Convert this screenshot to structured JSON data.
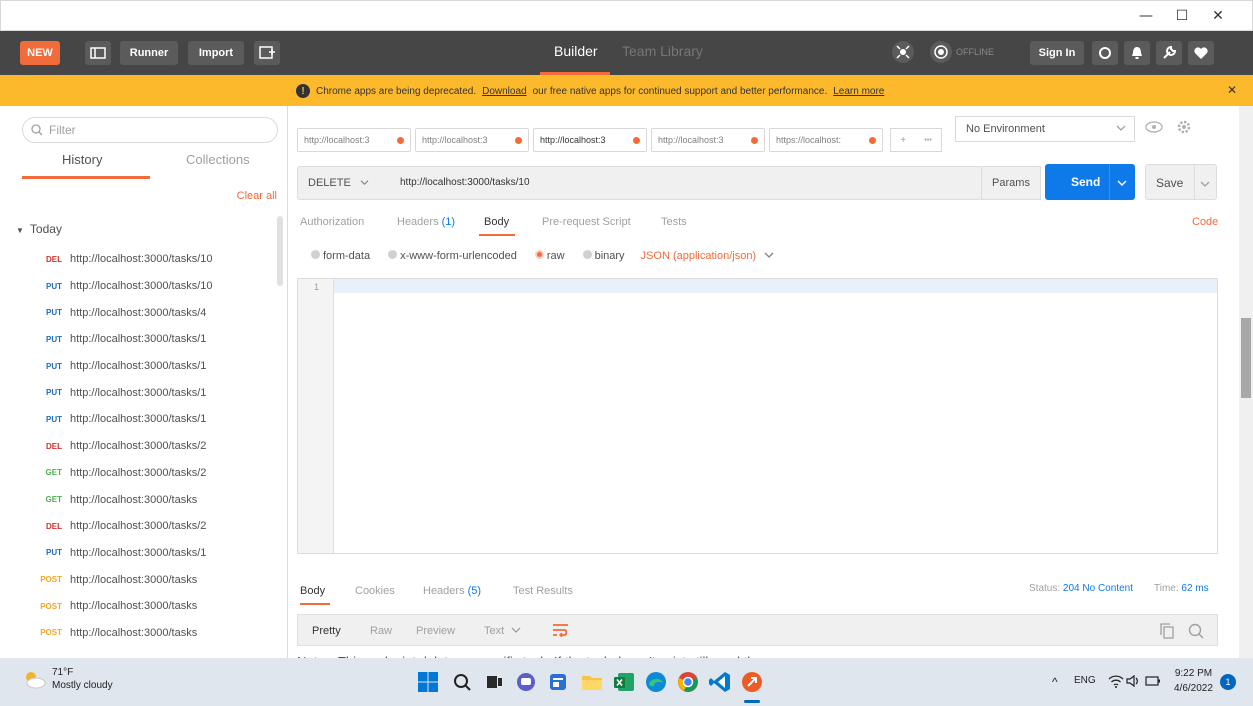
{
  "window": {
    "minimize": "—",
    "maximize": "☐",
    "close": "✕"
  },
  "header": {
    "new_label": "NEW",
    "runner_label": "Runner",
    "import_label": "Import",
    "builder_label": "Builder",
    "team_library_label": "Team Library",
    "offline_label": "OFFLINE",
    "sign_in_label": "Sign In"
  },
  "banner": {
    "text_before": "Chrome apps are being deprecated.",
    "download_link": "Download",
    "text_after": "our free native apps for continued support and better performance.",
    "learn_more": "Learn more",
    "close": "✕"
  },
  "sidebar": {
    "filter_placeholder": "Filter",
    "tabs": [
      "History",
      "Collections"
    ],
    "clear_all": "Clear all",
    "group_label": "Today",
    "items": [
      {
        "method": "DEL",
        "url": "http://localhost:3000/tasks/10",
        "color": "#d0312d"
      },
      {
        "method": "PUT",
        "url": "http://localhost:3000/tasks/10",
        "color": "#1e6bbf"
      },
      {
        "method": "PUT",
        "url": "http://localhost:3000/tasks/4",
        "color": "#1e6bbf"
      },
      {
        "method": "PUT",
        "url": "http://localhost:3000/tasks/1",
        "color": "#1e6bbf"
      },
      {
        "method": "PUT",
        "url": "http://localhost:3000/tasks/1",
        "color": "#1e6bbf"
      },
      {
        "method": "PUT",
        "url": "http://localhost:3000/tasks/1",
        "color": "#1e6bbf"
      },
      {
        "method": "PUT",
        "url": "http://localhost:3000/tasks/1",
        "color": "#1e6bbf"
      },
      {
        "method": "DEL",
        "url": "http://localhost:3000/tasks/2",
        "color": "#d0312d"
      },
      {
        "method": "GET",
        "url": "http://localhost:3000/tasks/2",
        "color": "#4caf50"
      },
      {
        "method": "GET",
        "url": "http://localhost:3000/tasks",
        "color": "#4caf50"
      },
      {
        "method": "DEL",
        "url": "http://localhost:3000/tasks/2",
        "color": "#d0312d"
      },
      {
        "method": "PUT",
        "url": "http://localhost:3000/tasks/1",
        "color": "#1e6bbf"
      },
      {
        "method": "POST",
        "url": "http://localhost:3000/tasks",
        "color": "#f5a623"
      },
      {
        "method": "POST",
        "url": "http://localhost:3000/tasks",
        "color": "#f5a623"
      },
      {
        "method": "POST",
        "url": "http://localhost:3000/tasks",
        "color": "#f5a623"
      }
    ]
  },
  "request_tabs": [
    {
      "label": "http://localhost:3",
      "active": false
    },
    {
      "label": "http://localhost:3",
      "active": false
    },
    {
      "label": "http://localhost:3",
      "active": true
    },
    {
      "label": "http://localhost:3",
      "active": false
    },
    {
      "label": "https://localhost:",
      "active": false
    }
  ],
  "tab_add": "+",
  "tab_more": "•••",
  "environment": {
    "selected": "No Environment"
  },
  "request": {
    "method": "DELETE",
    "url": "http://localhost:3000/tasks/10",
    "params_label": "Params",
    "send_label": "Send",
    "save_label": "Save"
  },
  "sub_tabs": {
    "authorization": "Authorization",
    "headers": "Headers",
    "headers_count": "(1)",
    "body": "Body",
    "pre_request": "Pre-request Script",
    "tests": "Tests",
    "code": "Code"
  },
  "body_options": {
    "form_data": "form-data",
    "urlencoded": "x-www-form-urlencoded",
    "raw": "raw",
    "binary": "binary",
    "content_type": "JSON (application/json)"
  },
  "editor": {
    "line_number": "1"
  },
  "response": {
    "tabs": {
      "body": "Body",
      "cookies": "Cookies",
      "headers": "Headers",
      "headers_count": "(5)",
      "test_results": "Test Results"
    },
    "status_label": "Status:",
    "status_value": "204 No Content",
    "time_label": "Time:",
    "time_value": "62 ms",
    "view_modes": {
      "pretty": "Pretty",
      "raw": "Raw",
      "preview": "Preview",
      "format": "Text"
    },
    "notes": "Notes: This endpoint deletes a specific task. If the task doesn't exist still send the same response"
  },
  "taskbar": {
    "temperature": "71°F",
    "weather": "Mostly cloudy",
    "language": "ENG",
    "time": "9:22 PM",
    "date": "4/6/2022",
    "notification_count": "1"
  }
}
